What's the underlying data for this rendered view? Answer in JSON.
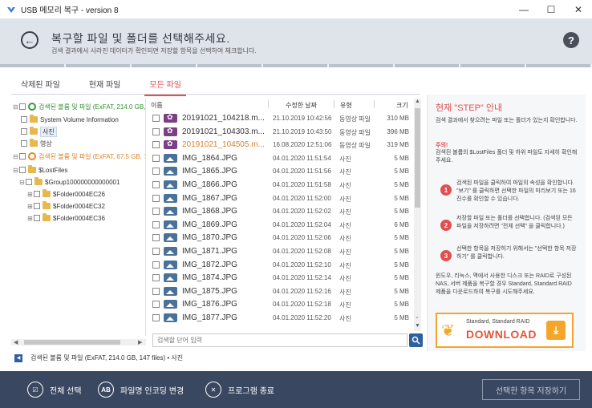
{
  "window": {
    "title": "USB 메모리 복구 - version 8",
    "minimize": "—",
    "maximize": "☐",
    "close": "✕"
  },
  "header": {
    "title": "복구할 파일 및 폴더를 선택해주세요.",
    "subtitle": "검색 결과에서 사라진 데이터가 확인되면 저장할 항목을 선택하여 체크합니다.",
    "help": "?",
    "back": "←"
  },
  "tabs": [
    {
      "label": "삭제된 파일"
    },
    {
      "label": "현재 파일"
    },
    {
      "label": "모든 파일"
    }
  ],
  "tree": {
    "vol1": "검색된 볼륨 및 파일 (ExFAT, 214.0 GB, 147 files)",
    "svi": "System Volume Information",
    "photo": "사진",
    "video": "영상",
    "vol2": "검색된 볼륨 및 파일 (ExFAT, 67.5 GB, 7",
    "lostfiles": "$LostFiles",
    "group": "$Group100000000000001",
    "f1": "$Folder0004EC26",
    "f2": "$Folder0004EC32",
    "f3": "$Folder0004EC36"
  },
  "columns": {
    "name": "이름",
    "date": "수정한 날짜",
    "type": "유형",
    "size": "크기"
  },
  "files": [
    {
      "name": "20191021_104218.m...",
      "date": "21.10.2019 10:42:56",
      "type": "동영상 파일",
      "size": "310 MB",
      "kind": "video"
    },
    {
      "name": "20191021_104303.m...",
      "date": "21.10.2019 10:43:50",
      "type": "동영상 파일",
      "size": "396 MB",
      "kind": "video"
    },
    {
      "name": "20191021_104505.m...",
      "date": "16.08.2020 12:51:06",
      "type": "동영상 파일",
      "size": "319 MB",
      "kind": "video"
    },
    {
      "name": "IMG_1864.JPG",
      "date": "04.01.2020 11:51:54",
      "type": "사진",
      "size": "5 MB",
      "kind": "img"
    },
    {
      "name": "IMG_1865.JPG",
      "date": "04.01.2020 11:51:56",
      "type": "사진",
      "size": "5 MB",
      "kind": "img"
    },
    {
      "name": "IMG_1866.JPG",
      "date": "04.01.2020 11:51:58",
      "type": "사진",
      "size": "5 MB",
      "kind": "img"
    },
    {
      "name": "IMG_1867.JPG",
      "date": "04.01.2020 11:52:00",
      "type": "사진",
      "size": "5 MB",
      "kind": "img"
    },
    {
      "name": "IMG_1868.JPG",
      "date": "04.01.2020 11:52:02",
      "type": "사진",
      "size": "5 MB",
      "kind": "img"
    },
    {
      "name": "IMG_1869.JPG",
      "date": "04.01.2020 11:52:04",
      "type": "사진",
      "size": "6 MB",
      "kind": "img"
    },
    {
      "name": "IMG_1870.JPG",
      "date": "04.01.2020 11:52:06",
      "type": "사진",
      "size": "5 MB",
      "kind": "img"
    },
    {
      "name": "IMG_1871.JPG",
      "date": "04.01.2020 11:52:08",
      "type": "사진",
      "size": "5 MB",
      "kind": "img"
    },
    {
      "name": "IMG_1872.JPG",
      "date": "04.01.2020 11:52:10",
      "type": "사진",
      "size": "5 MB",
      "kind": "img"
    },
    {
      "name": "IMG_1874.JPG",
      "date": "04.01.2020 11:52:14",
      "type": "사진",
      "size": "5 MB",
      "kind": "img"
    },
    {
      "name": "IMG_1875.JPG",
      "date": "04.01.2020 11:52:16",
      "type": "사진",
      "size": "5 MB",
      "kind": "img"
    },
    {
      "name": "IMG_1876.JPG",
      "date": "04.01.2020 11:52:18",
      "type": "사진",
      "size": "5 MB",
      "kind": "img"
    },
    {
      "name": "IMG_1877.JPG",
      "date": "04.01.2020 11:52:20",
      "type": "사진",
      "size": "5 MB",
      "kind": "img"
    }
  ],
  "search": {
    "placeholder": "검색할 단어 입력"
  },
  "guide": {
    "title": "현재 \"STEP\" 안내",
    "intro": "검색 결과에서 찾으려는 파일 또는 폴더가 있는지 확인합니다.",
    "warn": "주의!",
    "warn_text": "검색된 볼륨의 $LostFiles 폴더 및 하위 파일도 자세히 확인해주세요.",
    "steps": [
      {
        "num": "1",
        "text": "검색된 파일을 클릭하여 파일의 속성을 확인합니다. \"보기\" 를 클릭하면 선택한 파일의 미리보기 또는 16진수를 확인할 수 있습니다."
      },
      {
        "num": "2",
        "text": "저장할 파일 또는 폴더를 선택합니다. (검색된 모든 파일을 저장하려면 \"전체 선택\" 을 클릭합니다.)"
      },
      {
        "num": "3",
        "text": "선택한 항목을 저장하기 위해서는 \"선택한 항목 저장하기\" 를 클릭합니다."
      }
    ],
    "raid": "윈도우, 리눅스, 맥에서 사용한 디스크 또는 RAID로 구성된 NAS, 서버 제품을 복구할 경우 Standard, Standard RAID 제품을 다운로드하여 복구를 시도해주세요."
  },
  "banner": {
    "sub": "Standard, Standard RAID",
    "main": "DOWNLOAD"
  },
  "status": {
    "text": "검색된 볼륨 및 파일 (ExFAT, 214.0 GB, 147 files)  • 사진"
  },
  "footer": {
    "select_all": "전체 선택",
    "encoding": "파일명 인코딩 변경",
    "exit": "프로그램 종료",
    "save": "선택한 항목 저장하기",
    "encoding_icon": "AB"
  },
  "colors": {
    "accent": "#e14f50",
    "footer_bg": "#3a4760",
    "header_bg": "#dfe3ea",
    "link_blue": "#2f5f9e"
  }
}
